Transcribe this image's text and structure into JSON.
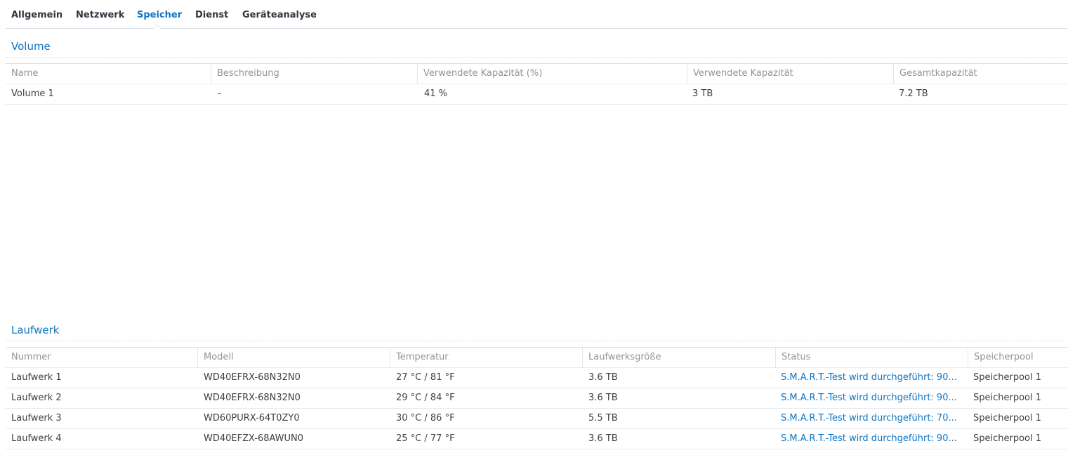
{
  "tabs": [
    {
      "label": "Allgemein",
      "active": false
    },
    {
      "label": "Netzwerk",
      "active": false
    },
    {
      "label": "Speicher",
      "active": true
    },
    {
      "label": "Dienst",
      "active": false
    },
    {
      "label": "Geräteanalyse",
      "active": false
    }
  ],
  "volume": {
    "title": "Volume",
    "columns": [
      "Name",
      "Beschreibung",
      "Verwendete Kapazität (%)",
      "Verwendete Kapazität",
      "Gesamtkapazität"
    ],
    "rows": [
      [
        "Volume 1",
        "-",
        "41 %",
        "3 TB",
        "7.2 TB"
      ]
    ]
  },
  "drives": {
    "title": "Laufwerk",
    "columns": [
      "Nummer",
      "Modell",
      "Temperatur",
      "Laufwerksgröße",
      "Status",
      "Speicherpool"
    ],
    "rows": [
      [
        "Laufwerk 1",
        "WD40EFRX-68N32N0",
        "27 °C / 81 °F",
        "3.6 TB",
        "S.M.A.R.T.-Test wird durchgeführt: 90...",
        "Speicherpool 1"
      ],
      [
        "Laufwerk 2",
        "WD40EFRX-68N32N0",
        "29 °C / 84 °F",
        "3.6 TB",
        "S.M.A.R.T.-Test wird durchgeführt: 90...",
        "Speicherpool 1"
      ],
      [
        "Laufwerk 3",
        "WD60PURX-64T0ZY0",
        "30 °C / 86 °F",
        "5.5 TB",
        "S.M.A.R.T.-Test wird durchgeführt: 70...",
        "Speicherpool 1"
      ],
      [
        "Laufwerk 4",
        "WD40EFZX-68AWUN0",
        "25 °C / 77 °F",
        "3.6 TB",
        "S.M.A.R.T.-Test wird durchgeführt: 90...",
        "Speicherpool 1"
      ]
    ]
  },
  "colors": {
    "accent": "#0f75c2",
    "text": "#404040",
    "header_text": "#8e959d"
  }
}
